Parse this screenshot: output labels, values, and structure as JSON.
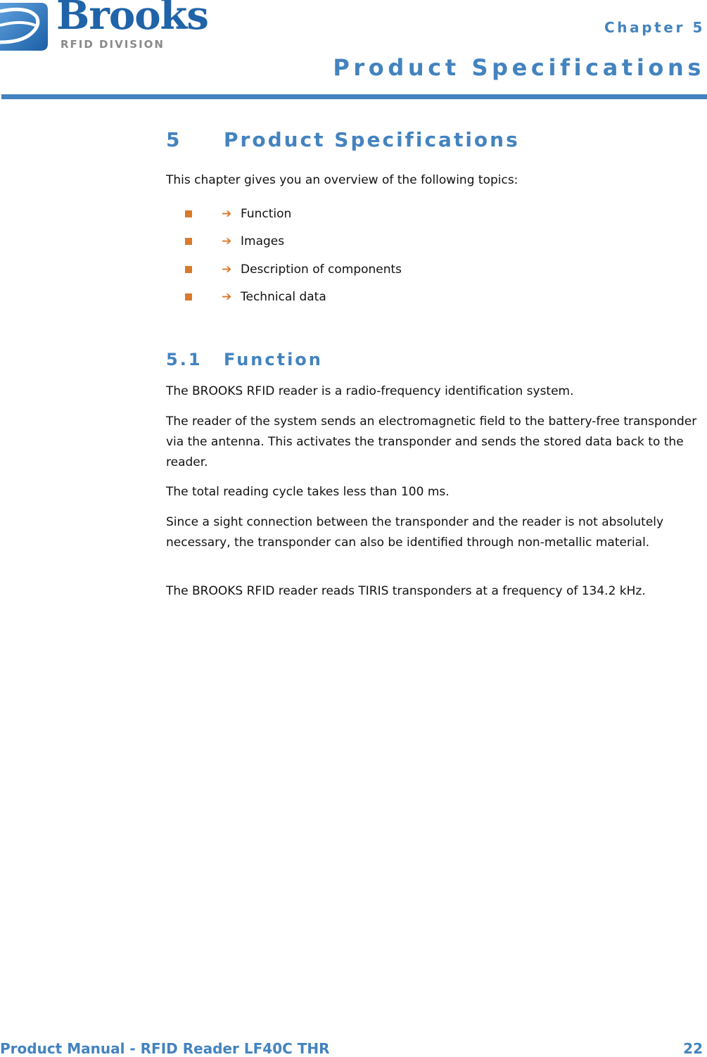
{
  "header": {
    "logo": {
      "wordmark": "Brooks",
      "subtitle": "RFID DIVISION",
      "brand_color": "#1f63a8"
    },
    "chapter_label": "Chapter 5",
    "chapter_title": "Product Specifications",
    "accent_color": "#4383bf"
  },
  "section": {
    "number": "5",
    "title": "Product Specifications",
    "intro": "This chapter gives you an overview of the following topics:",
    "topics": [
      {
        "label": "Function",
        "icon": "arrow-right-icon"
      },
      {
        "label": "Images",
        "icon": "arrow-right-icon"
      },
      {
        "label": "Description of components",
        "icon": "arrow-right-icon"
      },
      {
        "label": "Technical data",
        "icon": "arrow-right-icon"
      }
    ],
    "bullet_color": "#d97a2b"
  },
  "subsection": {
    "number": "5.1",
    "title": "Function",
    "paragraphs": [
      "The BROOKS RFID reader is a radio-frequency identification system.",
      "The reader of the system sends an electromagnetic field to the battery-free transponder via the antenna. This activates the transponder and sends the stored data back to the reader.",
      "The total reading cycle takes less than 100 ms.",
      "Since a sight connection between the transponder and the reader is not absolutely necessary, the transponder can also be identified through non-metallic material.",
      "The BROOKS RFID reader reads TIRIS transponders at a frequency of 134.2 kHz."
    ]
  },
  "footer": {
    "title": "Product Manual - RFID Reader LF40C THR",
    "page_number": "22"
  }
}
